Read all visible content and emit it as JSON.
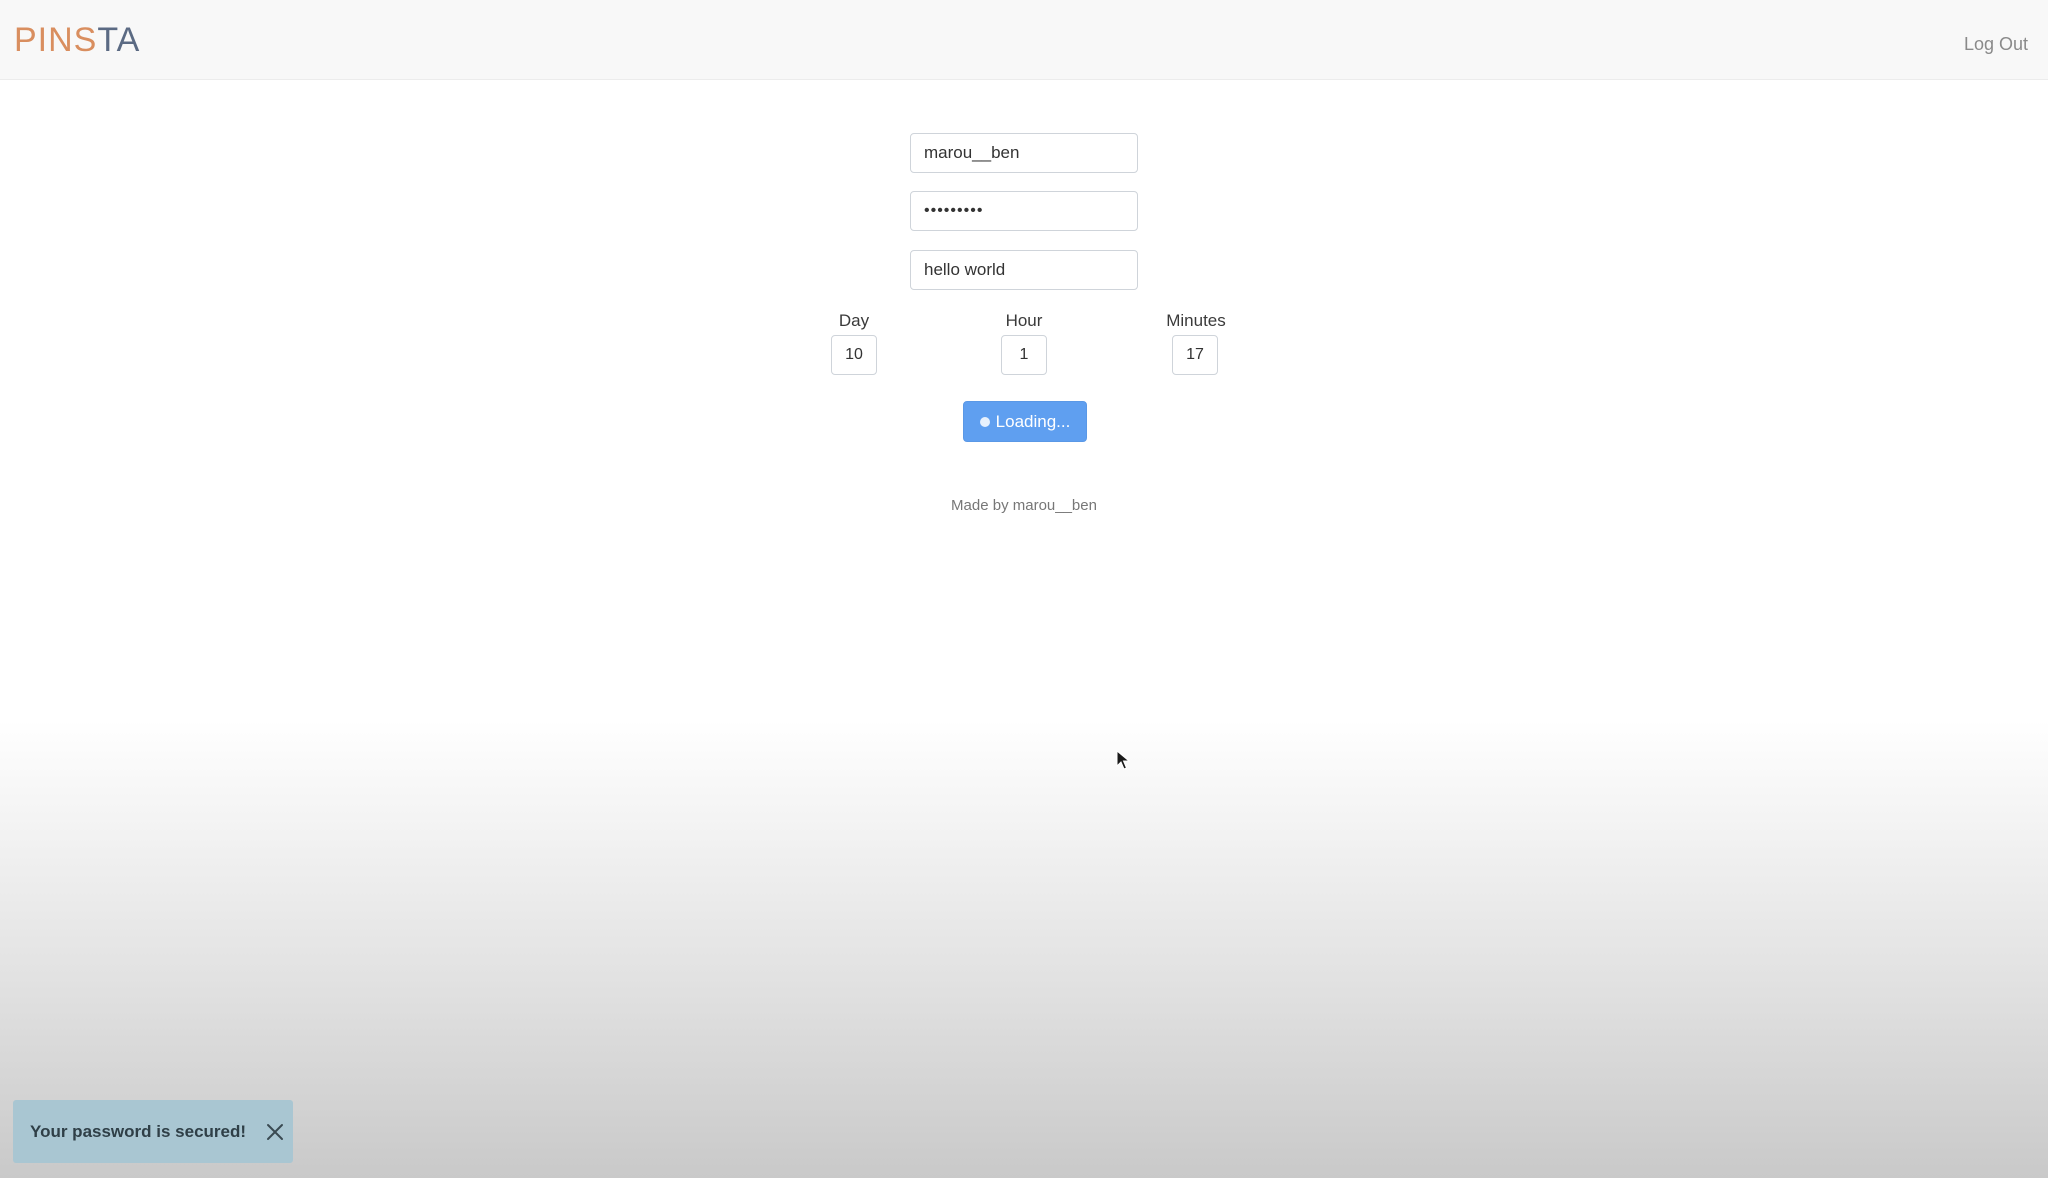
{
  "header": {
    "brand_part1": "PINS",
    "brand_part2": "TA",
    "logout_label": "Log Out"
  },
  "form": {
    "username_value": "marou__ben",
    "password_value": "•••••••••",
    "message_value": "hello world",
    "schedule": {
      "day_label": "Day",
      "day_value": "10",
      "hour_label": "Hour",
      "hour_value": "1",
      "minutes_label": "Minutes",
      "minutes_value": "17"
    },
    "submit_label": "Loading..."
  },
  "footer": {
    "credit": "Made by marou__ben"
  },
  "toast": {
    "message": "Your password is secured!"
  },
  "icons": {
    "toast_close": "close-icon",
    "spinner": "spinner-icon",
    "cursor": "mouse-pointer-icon"
  },
  "colors": {
    "brand_orange": "#d98e5f",
    "brand_slate": "#5b6a83",
    "button_blue": "#5f9ff0",
    "toast_bg": "#a9c6d2"
  }
}
